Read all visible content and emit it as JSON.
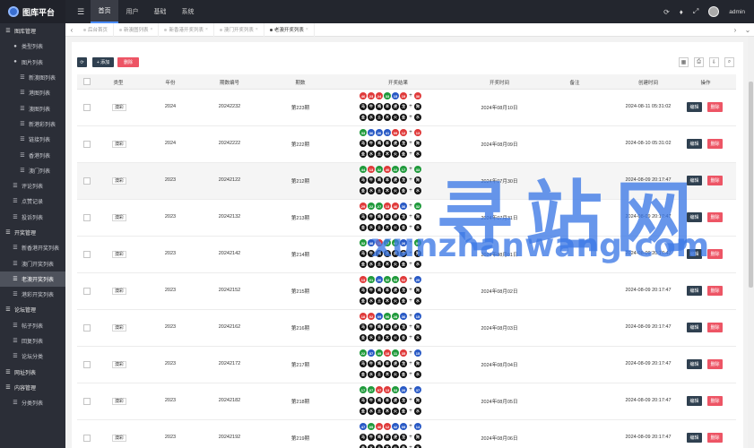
{
  "app": {
    "title": "图库平台",
    "user": "admin"
  },
  "topnav": [
    "首页",
    "用户",
    "基础",
    "系统"
  ],
  "sidebar": [
    {
      "label": "图库管理",
      "level": 1,
      "icon": "☰"
    },
    {
      "label": "类型列表",
      "level": 2,
      "icon": "●"
    },
    {
      "label": "图片列表",
      "level": 2,
      "icon": "●"
    },
    {
      "label": "新澳图列表",
      "level": 3,
      "icon": "☰"
    },
    {
      "label": "港图列表",
      "level": 3,
      "icon": "☰"
    },
    {
      "label": "澳图列表",
      "level": 3,
      "icon": "☰"
    },
    {
      "label": "新港彩列表",
      "level": 3,
      "icon": "☰"
    },
    {
      "label": "链接列表",
      "level": 3,
      "icon": "☰"
    },
    {
      "label": "香港列表",
      "level": 3,
      "icon": "☰"
    },
    {
      "label": "澳门列表",
      "level": 3,
      "icon": "☰"
    },
    {
      "label": "评论列表",
      "level": 2,
      "icon": "☰"
    },
    {
      "label": "点赞记录",
      "level": 2,
      "icon": "☰"
    },
    {
      "label": "投诉列表",
      "level": 2,
      "icon": "☰"
    },
    {
      "label": "开奖管理",
      "level": 1,
      "icon": "☰"
    },
    {
      "label": "新香港开奖列表",
      "level": 2,
      "icon": "☰"
    },
    {
      "label": "澳门开奖列表",
      "level": 2,
      "icon": "☰"
    },
    {
      "label": "老澳开奖列表",
      "level": 2,
      "icon": "☰",
      "active": true
    },
    {
      "label": "港彩开奖列表",
      "level": 2,
      "icon": "☰"
    },
    {
      "label": "论坛管理",
      "level": 1,
      "icon": "☰"
    },
    {
      "label": "帖子列表",
      "level": 2,
      "icon": "☰"
    },
    {
      "label": "回复列表",
      "level": 2,
      "icon": "☰"
    },
    {
      "label": "论坛分类",
      "level": 2,
      "icon": "☰"
    },
    {
      "label": "网址列表",
      "level": 1,
      "icon": "☰"
    },
    {
      "label": "内容管理",
      "level": 1,
      "icon": "☰"
    },
    {
      "label": "分类列表",
      "level": 2,
      "icon": "☰"
    }
  ],
  "tabs": [
    {
      "label": "后台首页",
      "active": false
    },
    {
      "label": "新澳图列表",
      "active": false
    },
    {
      "label": "新香港开奖列表",
      "active": false
    },
    {
      "label": "澳门开奖列表",
      "active": false
    },
    {
      "label": "老澳开奖列表",
      "active": true
    }
  ],
  "toolbar": {
    "add": "+ 添加",
    "delete": "删除"
  },
  "columns": [
    "类型",
    "年份",
    "期数编号",
    "期数",
    "开奖结果",
    "开奖时间",
    "备注",
    "创建时间",
    "操作"
  ],
  "actions": {
    "edit": "编辑",
    "delete": "删除"
  },
  "rows": [
    {
      "type": "澳彩",
      "year": "2024",
      "code": "20242232",
      "issue": "第223期",
      "draw_time": "2024年08月10日",
      "created": "2024-08-11 05:31:02",
      "balls": [
        [
          "46",
          "red"
        ],
        [
          "23",
          "red"
        ],
        [
          "24",
          "red"
        ],
        [
          "33",
          "green"
        ],
        [
          "15",
          "blue"
        ],
        [
          "19",
          "red"
        ],
        [
          "30",
          "red"
        ]
      ]
    },
    {
      "type": "澳彩",
      "year": "2024",
      "code": "20242222",
      "issue": "第222期",
      "draw_time": "2024年08月09日",
      "created": "2024-08-10 05:31:02",
      "balls": [
        [
          "33",
          "green"
        ],
        [
          "36",
          "blue"
        ],
        [
          "26",
          "blue"
        ],
        [
          "41",
          "blue"
        ],
        [
          "09",
          "red"
        ],
        [
          "12",
          "red"
        ],
        [
          "13",
          "red"
        ]
      ]
    },
    {
      "type": "澳彩",
      "year": "2023",
      "code": "20242122",
      "issue": "第212期",
      "draw_time": "2024年07月30日",
      "created": "2024-08-09 20:17:47",
      "balls": [
        [
          "44",
          "green"
        ],
        [
          "13",
          "red"
        ],
        [
          "32",
          "green"
        ],
        [
          "40",
          "red"
        ],
        [
          "22",
          "green"
        ],
        [
          "17",
          "green"
        ],
        [
          "33",
          "green"
        ]
      ]
    },
    {
      "type": "澳彩",
      "year": "2023",
      "code": "20242132",
      "issue": "第213期",
      "draw_time": "2024年07月31日",
      "created": "2024-08-09 20:17:47",
      "balls": [
        [
          "29",
          "red"
        ],
        [
          "22",
          "green"
        ],
        [
          "27",
          "green"
        ],
        [
          "13",
          "red"
        ],
        [
          "46",
          "red"
        ],
        [
          "36",
          "blue"
        ],
        [
          "32",
          "green"
        ]
      ]
    },
    {
      "type": "澳彩",
      "year": "2023",
      "code": "20242142",
      "issue": "第214期",
      "draw_time": "2024年08月01日",
      "created": "2024-08-09 20:17:47",
      "balls": [
        [
          "32",
          "green"
        ],
        [
          "48",
          "blue"
        ],
        [
          "18",
          "red"
        ],
        [
          "27",
          "green"
        ],
        [
          "44",
          "green"
        ],
        [
          "26",
          "blue"
        ],
        [
          "06",
          "green"
        ]
      ]
    },
    {
      "type": "澳彩",
      "year": "2023",
      "code": "20242152",
      "issue": "第215期",
      "draw_time": "2024年08月02日",
      "created": "2024-08-09 20:17:47",
      "balls": [
        [
          "13",
          "red"
        ],
        [
          "21",
          "green"
        ],
        [
          "26",
          "blue"
        ],
        [
          "32",
          "green"
        ],
        [
          "33",
          "green"
        ],
        [
          "02",
          "red"
        ],
        [
          "20",
          "blue"
        ]
      ]
    },
    {
      "type": "澳彩",
      "year": "2023",
      "code": "20242162",
      "issue": "第216期",
      "draw_time": "2024年08月03日",
      "created": "2024-08-09 20:17:47",
      "balls": [
        [
          "18",
          "red"
        ],
        [
          "02",
          "red"
        ],
        [
          "09",
          "blue"
        ],
        [
          "06",
          "green"
        ],
        [
          "28",
          "green"
        ],
        [
          "36",
          "blue"
        ],
        [
          "15",
          "blue"
        ]
      ]
    },
    {
      "type": "澳彩",
      "year": "2023",
      "code": "20242172",
      "issue": "第217期",
      "draw_time": "2024年08月04日",
      "created": "2024-08-09 20:17:47",
      "balls": [
        [
          "22",
          "green"
        ],
        [
          "37",
          "blue"
        ],
        [
          "49",
          "green"
        ],
        [
          "18",
          "red"
        ],
        [
          "11",
          "green"
        ],
        [
          "35",
          "red"
        ],
        [
          "15",
          "blue"
        ]
      ]
    },
    {
      "type": "澳彩",
      "year": "2023",
      "code": "20242182",
      "issue": "第218期",
      "draw_time": "2024年08月05日",
      "created": "2024-08-09 20:17:47",
      "balls": [
        [
          "17",
          "green"
        ],
        [
          "27",
          "green"
        ],
        [
          "07",
          "red"
        ],
        [
          "13",
          "red"
        ],
        [
          "33",
          "green"
        ],
        [
          "20",
          "blue"
        ],
        [
          "37",
          "blue"
        ]
      ]
    },
    {
      "type": "澳彩",
      "year": "2023",
      "code": "20242192",
      "issue": "第219期",
      "draw_time": "2024年08月06日",
      "created": "2024-08-09 20:17:47",
      "balls": [
        [
          "47",
          "blue"
        ],
        [
          "05",
          "green"
        ],
        [
          "46",
          "red"
        ],
        [
          "12",
          "red"
        ],
        [
          "42",
          "blue"
        ],
        [
          "09",
          "blue"
        ],
        [
          "14",
          "blue"
        ]
      ]
    }
  ],
  "zodiac_row1": [
    "马",
    "牛",
    "鸡",
    "羊",
    "虎",
    "龙",
    "狗"
  ],
  "zodiac_row2": [
    "金",
    "水",
    "土",
    "木",
    "火",
    "金",
    "水"
  ],
  "watermark": {
    "main": "寻站网",
    "sub": "xunzhanwang.com"
  }
}
